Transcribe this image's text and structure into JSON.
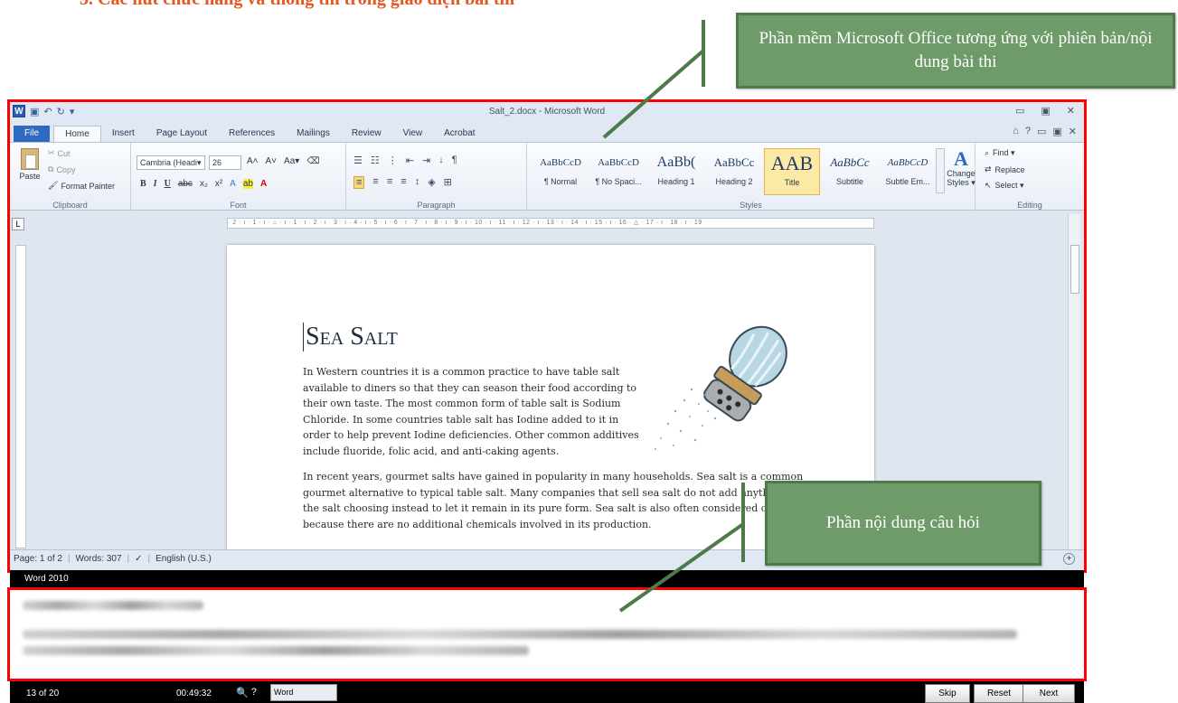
{
  "page_heading": "3.   Các nút chức năng và thông tin trong giao diện bài thi",
  "callouts": {
    "software": "Phần mềm Microsoft Office tương ứng  với phiên bản/nội dung bài thi",
    "question": "Phần nội dung câu hỏi"
  },
  "word": {
    "title": "Salt_2.docx - Microsoft Word",
    "app_icon": "W",
    "tabs": [
      "File",
      "Home",
      "Insert",
      "Page Layout",
      "References",
      "Mailings",
      "Review",
      "View",
      "Acrobat"
    ],
    "active_tab": "Home",
    "clipboard": {
      "paste": "Paste",
      "cut": "Cut",
      "copy": "Copy",
      "format_painter": "Format Painter",
      "label": "Clipboard"
    },
    "font": {
      "name": "Cambria (Headi▾",
      "size": "26",
      "label": "Font"
    },
    "paragraph": {
      "label": "Paragraph"
    },
    "styles": {
      "label": "Styles",
      "items": [
        {
          "sample": "AaBbCcD",
          "name": "¶ Normal"
        },
        {
          "sample": "AaBbCcD",
          "name": "¶ No Spaci..."
        },
        {
          "sample": "AaBb(",
          "name": "Heading 1"
        },
        {
          "sample": "AaBbCc",
          "name": "Heading 2"
        },
        {
          "sample": "AAB",
          "name": "Title"
        },
        {
          "sample": "AaBbCc",
          "name": "Subtitle"
        },
        {
          "sample": "AaBbCcD",
          "name": "Subtle Em..."
        }
      ],
      "change_styles": "Change Styles ▾"
    },
    "editing": {
      "find": "Find ▾",
      "replace": "Replace",
      "select": "Select ▾",
      "label": "Editing"
    },
    "ruler_text": "· 2 · ı · 1 · ı · ⌂ · ı · 1 · ı · 2 · ı · 3 · ı · 4 · ı · 5 · ı · 6 · ı · 7 · ı · 8 · ı · 9 · ı · 10 · ı · 11 · ı · 12 · ı · 13 · ı · 14 · ı · 15 · ı · 16 · △ · 17 · ı · 18 · ı · 19",
    "document": {
      "title": "Sea Salt",
      "paragraph1": "In Western countries it is a common practice to have table salt available to diners so that they can season their food according to their own taste. The most common form of table salt is Sodium Chloride. In some countries table salt has Iodine added to it in order to help prevent Iodine deficiencies. Other common additives include fluoride, folic acid, and anti-caking agents.",
      "paragraph2": "In recent years, gourmet salts have gained in popularity in many households. Sea salt is a common gourmet alternative to typical table salt. Many companies that sell sea salt do not add anything to the salt choosing instead to let it remain in its pure form. Sea salt is also often considered organic because there are no additional chemicals involved in its production."
    },
    "status": {
      "page": "Page: 1 of 2",
      "words": "Words: 307",
      "language": "English (U.S.)"
    }
  },
  "exam_bar": {
    "label": "Word 2010"
  },
  "bottom": {
    "count": "13 of 20",
    "timer": "00:49:32",
    "word_button": "Word",
    "skip": "Skip",
    "reset": "Reset",
    "next": "Next"
  },
  "colors": {
    "heading": "#e8551d",
    "callout_bg": "#6f9a6a",
    "frame": "#ff0000",
    "ribbon_file": "#2e6ac2"
  }
}
